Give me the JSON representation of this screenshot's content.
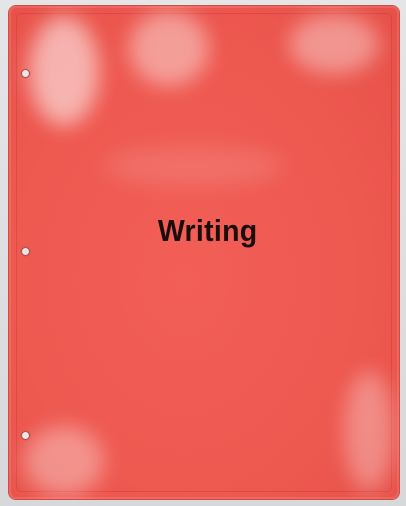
{
  "folder": {
    "label": "Writing",
    "color": "#ee5950",
    "hole_count": 3
  },
  "background_color": "#d9dadb"
}
